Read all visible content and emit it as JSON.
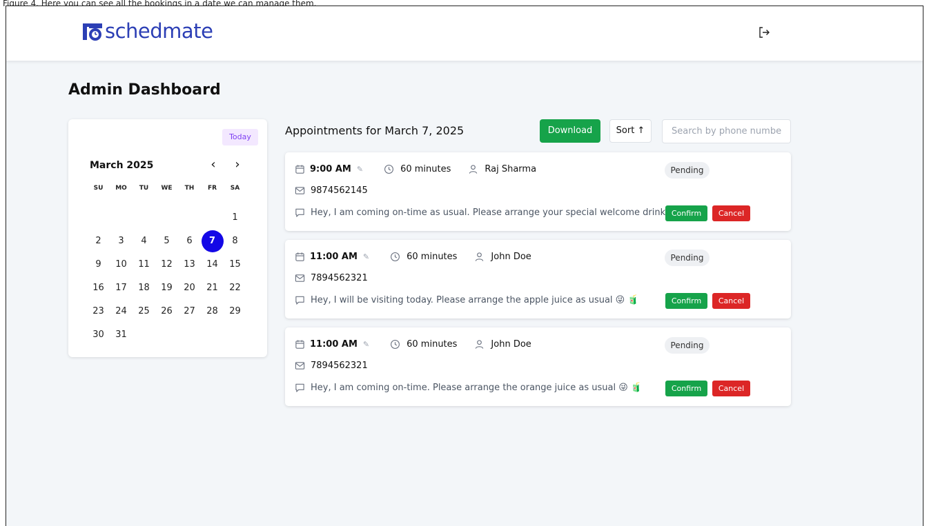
{
  "top_caption": "Figure 4. Here you can see all the bookings in a date we can manage them.",
  "header": {
    "logo_text": "schedmate",
    "brand_color": "#2c3fb5",
    "logout_icon": "logout-icon"
  },
  "page_title": "Admin Dashboard",
  "calendar": {
    "today_label": "Today",
    "month_label": "March 2025",
    "prev_label": "‹",
    "next_label": "›",
    "weekdays": [
      "SU",
      "MO",
      "TU",
      "WE",
      "TH",
      "FR",
      "SA"
    ],
    "leading_blanks": 6,
    "days": [
      "1",
      "2",
      "3",
      "4",
      "5",
      "6",
      "7",
      "8",
      "9",
      "10",
      "11",
      "12",
      "13",
      "14",
      "15",
      "16",
      "17",
      "18",
      "19",
      "20",
      "21",
      "22",
      "23",
      "24",
      "25",
      "26",
      "27",
      "28",
      "29",
      "30",
      "31"
    ],
    "selected_day": "7",
    "selected_color": "#1408e6"
  },
  "appointments": {
    "title": "Appointments for March 7, 2025",
    "download_label": "Download",
    "sort_label": "Sort ↑",
    "search_placeholder": "Search by phone number",
    "cards": [
      {
        "time": "9:00 AM",
        "duration": "60 minutes",
        "name": "Raj Sharma",
        "phone": "9874562145",
        "message": "Hey, I am coming on-time as usual. Please arrange your special welcome drink 😜 🧃",
        "status": "Pending",
        "confirm_label": "Confirm",
        "cancel_label": "Cancel"
      },
      {
        "time": "11:00 AM",
        "duration": "60 minutes",
        "name": "John Doe",
        "phone": "7894562321",
        "message": "Hey, I will be visiting today. Please arrange the apple juice as usual 😜 🧃",
        "status": "Pending",
        "confirm_label": "Confirm",
        "cancel_label": "Cancel"
      },
      {
        "time": "11:00 AM",
        "duration": "60 minutes",
        "name": "John Doe",
        "phone": "7894562321",
        "message": "Hey, I am coming on-time. Please arrange the orange juice as usual 😜 🧃",
        "status": "Pending",
        "confirm_label": "Confirm",
        "cancel_label": "Cancel"
      }
    ]
  },
  "colors": {
    "confirm": "#16a34a",
    "cancel": "#dc2626",
    "download": "#16a34a",
    "today_bg": "#f3e8ff",
    "today_text": "#7e3ff2"
  }
}
